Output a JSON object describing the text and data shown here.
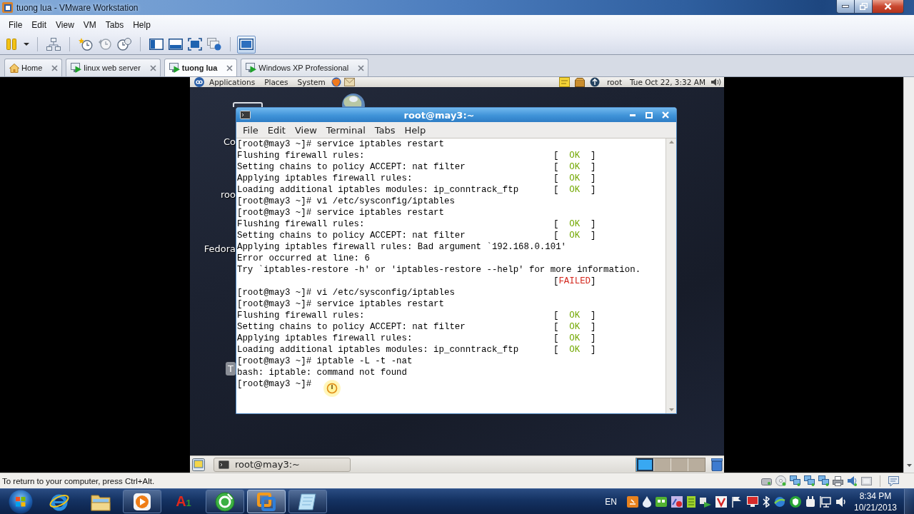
{
  "window": {
    "title": "tuong lua - VMware Workstation"
  },
  "menu": [
    "File",
    "Edit",
    "View",
    "VM",
    "Tabs",
    "Help"
  ],
  "toolbar": [
    {
      "kind": "pause",
      "selected": false
    },
    {
      "kind": "dropdown",
      "selected": false
    },
    {
      "kind": "send_keys",
      "selected": false
    },
    {
      "kind": "snapshot",
      "selected": false
    },
    {
      "kind": "revert",
      "selected": false
    },
    {
      "kind": "snapshot_manager",
      "selected": false
    },
    {
      "kind": "library",
      "selected": false
    },
    {
      "kind": "thumbnails",
      "selected": false
    },
    {
      "kind": "fullscreen",
      "selected": false
    },
    {
      "kind": "unity",
      "selected": false
    },
    {
      "kind": "console",
      "selected": true
    }
  ],
  "tabs": [
    {
      "label": "Home",
      "kind": "home",
      "selected": false
    },
    {
      "label": "linux web server",
      "kind": "vm",
      "selected": false
    },
    {
      "label": "tuong lua",
      "kind": "vm",
      "selected": true
    },
    {
      "label": "Windows XP Professional",
      "kind": "vm",
      "selected": false
    }
  ],
  "guest": {
    "top_panel": {
      "menus": [
        "Applications",
        "Places",
        "System"
      ],
      "user": "root",
      "clock": "Tue Oct 22, 3:32 AM"
    },
    "desktop_icons": [
      {
        "label": "Co",
        "selected": false
      },
      {
        "label": "roo",
        "selected": false
      },
      {
        "label": "Fedora",
        "selected": false
      },
      {
        "label": "T",
        "selected": true
      }
    ],
    "terminal": {
      "title": "root@may3:~",
      "menu": [
        "File",
        "Edit",
        "View",
        "Terminal",
        "Tabs",
        "Help"
      ],
      "lines": [
        {
          "text": "[root@may3 ~]# service iptables restart"
        },
        {
          "text": "Flushing firewall rules:",
          "status": {
            "kind": "ok",
            "open": "[",
            "label": "OK",
            "close": "]"
          }
        },
        {
          "text": "Setting chains to policy ACCEPT: nat filter",
          "status": {
            "kind": "ok",
            "open": "[",
            "label": "OK",
            "close": "]"
          }
        },
        {
          "text": "Applying iptables firewall rules:",
          "status": {
            "kind": "ok",
            "open": "[",
            "label": "OK",
            "close": "]"
          }
        },
        {
          "text": "Loading additional iptables modules: ip_conntrack_ftp",
          "status": {
            "kind": "ok",
            "open": "[",
            "label": "OK",
            "close": "]"
          }
        },
        {
          "text": "[root@may3 ~]# vi /etc/sysconfig/iptables"
        },
        {
          "text": "[root@may3 ~]# service iptables restart"
        },
        {
          "text": "Flushing firewall rules:",
          "status": {
            "kind": "ok",
            "open": "[",
            "label": "OK",
            "close": "]"
          }
        },
        {
          "text": "Setting chains to policy ACCEPT: nat filter",
          "status": {
            "kind": "ok",
            "open": "[",
            "label": "OK",
            "close": "]"
          }
        },
        {
          "text": "Applying iptables firewall rules: Bad argument `192.168.0.101'"
        },
        {
          "text": "Error occurred at line: 6"
        },
        {
          "text": "Try `iptables-restore -h' or 'iptables-restore --help' for more information."
        },
        {
          "status": {
            "kind": "failed",
            "open": "[",
            "label": "FAILED",
            "close": "]"
          }
        },
        {
          "text": "[root@may3 ~]# vi /etc/sysconfig/iptables"
        },
        {
          "text": "[root@may3 ~]# service iptables restart"
        },
        {
          "text": "Flushing firewall rules:",
          "status": {
            "kind": "ok",
            "open": "[",
            "label": "OK",
            "close": "]"
          }
        },
        {
          "text": "Setting chains to policy ACCEPT: nat filter",
          "status": {
            "kind": "ok",
            "open": "[",
            "label": "OK",
            "close": "]"
          }
        },
        {
          "text": "Applying iptables firewall rules:",
          "status": {
            "kind": "ok",
            "open": "[",
            "label": "OK",
            "close": "]"
          }
        },
        {
          "text": "Loading additional iptables modules: ip_conntrack_ftp",
          "status": {
            "kind": "ok",
            "open": "[",
            "label": "OK",
            "close": "]"
          }
        },
        {
          "text": "[root@may3 ~]# iptable -L -t -nat"
        },
        {
          "text": "bash: iptable: command not found"
        },
        {
          "text": "[root@may3 ~]#"
        }
      ]
    },
    "bottom_panel": {
      "tasks": [
        {
          "label": "root@may3:~"
        }
      ],
      "workspaces": [
        {
          "selected": true
        },
        {
          "selected": false
        },
        {
          "selected": false
        },
        {
          "selected": false
        }
      ]
    }
  },
  "status_bar": {
    "message": "To return to your computer, press Ctrl+Alt."
  },
  "taskbar": {
    "apps": [
      {
        "kind": "browser",
        "running": false,
        "selected": false
      },
      {
        "kind": "folder",
        "running": false,
        "selected": false
      },
      {
        "kind": "media",
        "running": true,
        "selected": false
      },
      {
        "kind": "text_logo",
        "logo_main": "A",
        "logo_sub": "1",
        "running": false,
        "selected": false
      },
      {
        "kind": "ring",
        "running": true,
        "selected": false
      },
      {
        "kind": "vmware",
        "running": true,
        "selected": true
      },
      {
        "kind": "notes",
        "running": true,
        "selected": false
      }
    ],
    "tray": {
      "language": "EN",
      "time": "8:34 PM",
      "date": "10/21/2013"
    }
  }
}
